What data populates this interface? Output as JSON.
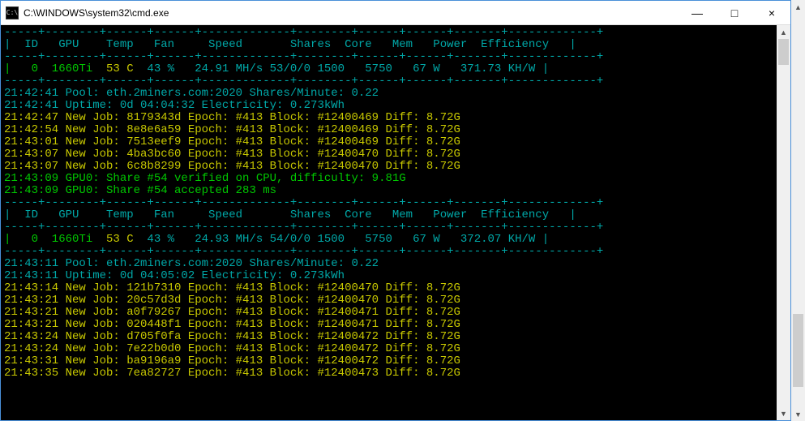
{
  "title_bar": {
    "icon": "C:\\",
    "title": "C:\\WINDOWS\\system32\\cmd.exe",
    "min": "—",
    "max": "□",
    "close": "×"
  },
  "border1": "-----+--------+------+------+-------------+--------+------+------+-------+-------------+",
  "header": "|  ID   GPU    Temp   Fan     Speed       Shares  Core   Mem   Power  Efficiency   |",
  "border2": "-----+--------+------+------+-------------+--------+------+------+-------+-------------+",
  "row1": {
    "id_gpu": "|   0  1660Ti",
    "temp": "  53 C ",
    "rest": " 43 %   24.91 MH/s 53/0/0 1500   5750   67 W   371.73 KH/W |"
  },
  "log1": {
    "pool_t": "21:42:41",
    "pool": " Pool: eth.2miners.com:2020 Shares/Minute: 0.22",
    "up_t": "21:42:41",
    "up": " Uptime: 0d 04:04:32 Electricity: 0.273kWh",
    "jobs": [
      {
        "t": "21:42:47",
        "l": " New Job: 8179343d Epoch: #413 Block: #12400469 Diff: 8.72G"
      },
      {
        "t": "21:42:54",
        "l": " New Job: 8e8e6a59 Epoch: #413 Block: #12400469 Diff: 8.72G"
      },
      {
        "t": "21:43:01",
        "l": " New Job: 7513eef9 Epoch: #413 Block: #12400469 Diff: 8.72G"
      },
      {
        "t": "21:43:07",
        "l": " New Job: 4ba3bc60 Epoch: #413 Block: #12400470 Diff: 8.72G"
      },
      {
        "t": "21:43:07",
        "l": " New Job: 6c8b8299 Epoch: #413 Block: #12400470 Diff: 8.72G"
      }
    ],
    "ver_t": "21:43:09",
    "ver": " GPU0: Share #54 verified on CPU, difficulty: 9.81G",
    "acc_t": "21:43:09",
    "acc": " GPU0: Share #54 accepted 283 ms"
  },
  "row2": {
    "id_gpu": "|   0  1660Ti",
    "temp": "  53 C ",
    "rest": " 43 %   24.93 MH/s 54/0/0 1500   5750   67 W   372.07 KH/W |"
  },
  "log2": {
    "pool_t": "21:43:11",
    "pool": " Pool: eth.2miners.com:2020 Shares/Minute: 0.22",
    "up_t": "21:43:11",
    "up": " Uptime: 0d 04:05:02 Electricity: 0.273kWh",
    "jobs": [
      {
        "t": "21:43:14",
        "l": " New Job: 121b7310 Epoch: #413 Block: #12400470 Diff: 8.72G"
      },
      {
        "t": "21:43:21",
        "l": " New Job: 20c57d3d Epoch: #413 Block: #12400470 Diff: 8.72G"
      },
      {
        "t": "21:43:21",
        "l": " New Job: a0f79267 Epoch: #413 Block: #12400471 Diff: 8.72G"
      },
      {
        "t": "21:43:21",
        "l": " New Job: 020448f1 Epoch: #413 Block: #12400471 Diff: 8.72G"
      },
      {
        "t": "21:43:24",
        "l": " New Job: d705f0fa Epoch: #413 Block: #12400472 Diff: 8.72G"
      },
      {
        "t": "21:43:24",
        "l": " New Job: 7e22b0d0 Epoch: #413 Block: #12400472 Diff: 8.72G"
      },
      {
        "t": "21:43:31",
        "l": " New Job: ba9196a9 Epoch: #413 Block: #12400472 Diff: 8.72G"
      },
      {
        "t": "21:43:35",
        "l": " New Job: 7ea82727 Epoch: #413 Block: #12400473 Diff: 8.72G"
      }
    ]
  }
}
